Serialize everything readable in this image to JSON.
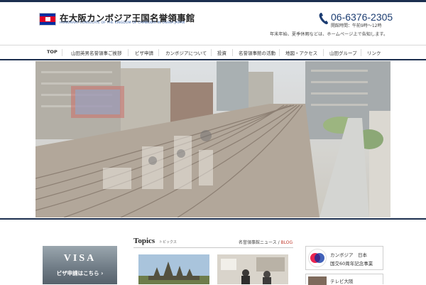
{
  "header": {
    "title": "在大阪カンボジア王国名誉領事館",
    "subtitle": "HONORARY CONSULATE OF THE KINGDOM OF CAMBODIA IN OSAKA JAPAN",
    "phone": "06-6376-2305",
    "hours": "開館時間：午前9時～12時",
    "notice": "年末年始、夏季休暇などは、ホームページ上で告知します。",
    "phone_icon": "phone-icon",
    "flag_icon": "cambodia-flag"
  },
  "nav": {
    "items": [
      {
        "label": "TOP"
      },
      {
        "label": "山田英男名誉領事ご挨拶"
      },
      {
        "label": "ビザ申請"
      },
      {
        "label": "カンボジアについて"
      },
      {
        "label": "投資"
      },
      {
        "label": "名誉領事館の活動"
      },
      {
        "label": "地図・アクセス"
      },
      {
        "label": "山田グループ"
      },
      {
        "label": "リンク"
      }
    ]
  },
  "visa": {
    "title": "VISA",
    "link": "ビザ申請はこちら ›"
  },
  "topics": {
    "title": "Topics",
    "subtitle": "トピックス",
    "link_news": "名誉領事館ニュース",
    "separator": " / ",
    "link_blog": "BLOG"
  },
  "side": {
    "banner_line1": "カンボジア　日本",
    "banner_line2": "国交60周年記念事業",
    "banner2_text": "テレビ大阪"
  },
  "colors": {
    "navy": "#1c2f4f",
    "accent_blue": "#3f66a6",
    "blog_red": "#c0392b"
  }
}
